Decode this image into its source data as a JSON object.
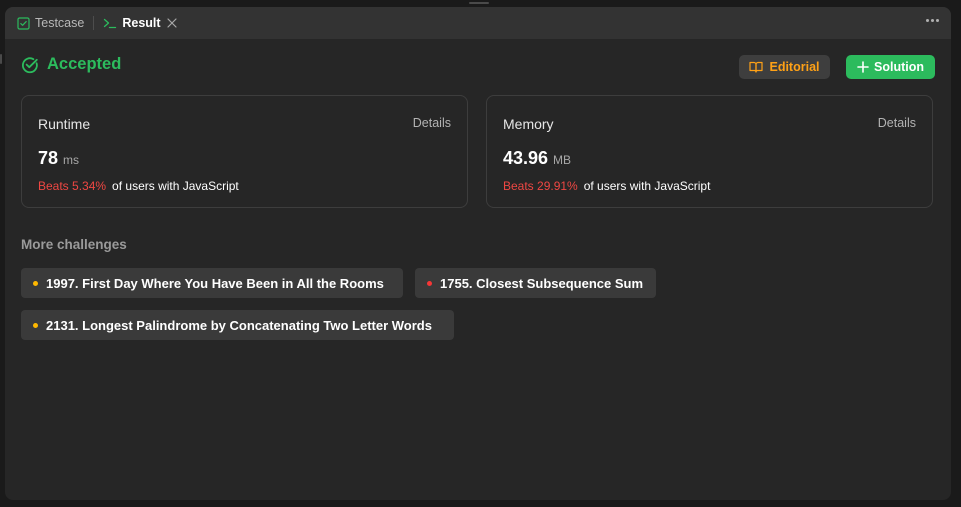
{
  "tabs": {
    "testcase_label": "Testcase",
    "result_label": "Result"
  },
  "status": {
    "label": "Accepted",
    "color": "#2cbb5d"
  },
  "actions": {
    "editorial_label": "Editorial",
    "solution_label": "Solution"
  },
  "runtime": {
    "title": "Runtime",
    "details_label": "Details",
    "value": "78",
    "unit": "ms",
    "beats": "Beats 5.34%",
    "suffix": "of users with JavaScript"
  },
  "memory": {
    "title": "Memory",
    "details_label": "Details",
    "value": "43.96",
    "unit": "MB",
    "beats": "Beats 29.91%",
    "suffix": "of users with JavaScript"
  },
  "more_challenges": {
    "title": "More challenges",
    "items": [
      {
        "label": "1997. First Day Where You Have Been in All the Rooms",
        "difficulty_color": "#ffb800"
      },
      {
        "label": "1755. Closest Subsequence Sum",
        "difficulty_color": "#f63636"
      },
      {
        "label": "2131. Longest Palindrome by Concatenating Two Letter Words",
        "difficulty_color": "#ffb800"
      }
    ]
  },
  "colors": {
    "accent_green": "#2cbb5d",
    "accent_orange": "#ffa116",
    "beats_red": "#ef4743",
    "medium_dot": "#ffb800",
    "hard_dot": "#f63636"
  },
  "icons": {
    "testcase_tab": "checkbox-icon",
    "result_tab": "terminal-icon",
    "close": "close-icon",
    "more": "more-dots-icon",
    "status": "check-circle-icon",
    "editorial": "book-icon",
    "solution": "plus-icon"
  }
}
